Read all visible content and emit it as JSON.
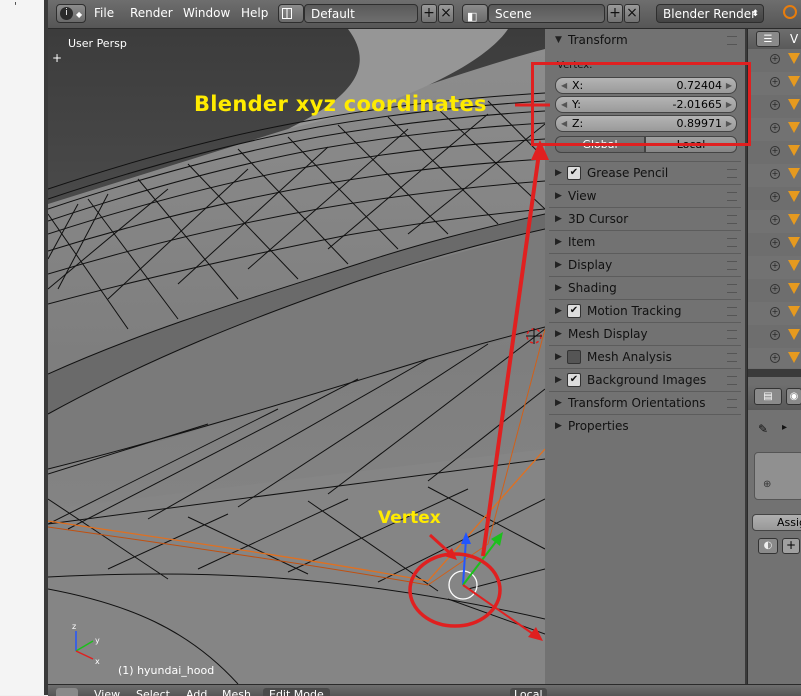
{
  "header": {
    "menu": [
      "File",
      "Render",
      "Window",
      "Help"
    ],
    "layout_name": "Default",
    "scene_name": "Scene",
    "render_engine": "Blender Render",
    "info_icon": "info-icon"
  },
  "viewport": {
    "view_label": "User Persp",
    "status": "(1) hyundai_hood"
  },
  "transform_panel": {
    "title": "Transform",
    "section_label": "Vertex:",
    "x_label": "X:",
    "x_value": "0.72404",
    "y_label": "Y:",
    "y_value": "-2.01665",
    "z_label": "Z:",
    "z_value": "0.89971",
    "global_label": "Global",
    "local_label": "Local"
  },
  "panels": [
    {
      "label": "Grease Pencil",
      "checkbox": true
    },
    {
      "label": "View",
      "checkbox": false
    },
    {
      "label": "3D Cursor",
      "checkbox": false
    },
    {
      "label": "Item",
      "checkbox": false
    },
    {
      "label": "Display",
      "checkbox": false
    },
    {
      "label": "Shading",
      "checkbox": false
    },
    {
      "label": "Motion Tracking",
      "checkbox": true
    },
    {
      "label": "Mesh Display",
      "checkbox": false
    },
    {
      "label": "Mesh Analysis",
      "checkbox": true,
      "checked": false
    },
    {
      "label": "Background Images",
      "checkbox": true
    },
    {
      "label": "Transform Orientations",
      "checkbox": false
    },
    {
      "label": "Properties",
      "checkbox": false
    }
  ],
  "outliner": {
    "header_letter": "V",
    "row_count": 14
  },
  "properties_editor": {
    "assign_label": "Assig"
  },
  "bottom_bar": {
    "items": [
      "View",
      "Select",
      "Add",
      "Mesh",
      "Edit Mode",
      "Local"
    ]
  },
  "annotations": {
    "coordinates_label": "Blender xyz coordinates",
    "vertex_label": "Vertex",
    "color": "#ffeb00",
    "highlight_color": "#e02020"
  }
}
